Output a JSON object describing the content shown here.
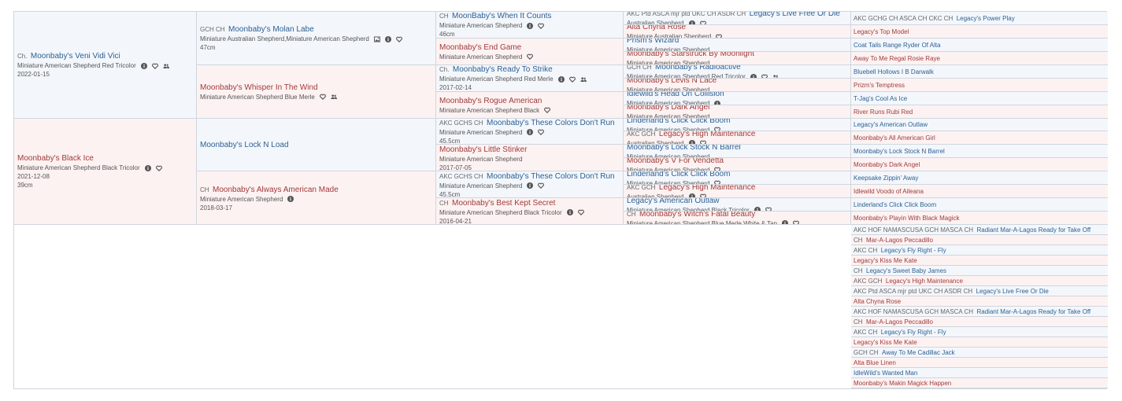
{
  "dogs": [
    {
      "gen": 0,
      "pos": 0,
      "sex": "sire",
      "title": "Ch.",
      "name": "Moonbaby's Veni Vidi Vici",
      "breed": "Miniature American Shepherd Red Tricolor",
      "date": "2022-01-15",
      "height": "",
      "icons": [
        "info-icon",
        "heart-icon",
        "people-icon"
      ]
    },
    {
      "gen": 0,
      "pos": 1,
      "sex": "dam",
      "title": "",
      "name": "Moonbaby's Black Ice",
      "breed": "Miniature American Shepherd Black Tricolor",
      "date": "2021-12-08",
      "height": "39cm",
      "icons": [
        "info-icon",
        "heart-icon"
      ]
    },
    {
      "gen": 1,
      "pos": 0,
      "sex": "sire",
      "title": "GCH CH",
      "name": "Moonbaby's Molan Labe",
      "breed": "Miniature Australian Shepherd,Miniature American Shepherd",
      "date": "",
      "height": "47cm",
      "icons": [
        "image-icon",
        "info-icon",
        "heart-icon"
      ]
    },
    {
      "gen": 1,
      "pos": 1,
      "sex": "dam",
      "title": "",
      "name": "Moonbaby's Whisper In The Wind",
      "breed": "Miniature American Shepherd Blue Merle",
      "date": "",
      "height": "",
      "icons": [
        "heart-icon",
        "people-icon"
      ]
    },
    {
      "gen": 1,
      "pos": 2,
      "sex": "sire",
      "title": "",
      "name": "Moonbaby's Lock N Load",
      "breed": "",
      "date": "",
      "height": "",
      "icons": []
    },
    {
      "gen": 1,
      "pos": 3,
      "sex": "dam",
      "title": "CH",
      "name": "Moonbaby's Always American Made",
      "breed": "Miniature American Shepherd",
      "date": "2018-03-17",
      "height": "",
      "icons": [
        "info-icon"
      ]
    },
    {
      "gen": 2,
      "pos": 0,
      "sex": "sire",
      "title": "CH",
      "name": "MoonBaby's When It Counts",
      "breed": "Miniature American Shepherd",
      "date": "",
      "height": "46cm",
      "icons": [
        "info-icon",
        "heart-icon"
      ]
    },
    {
      "gen": 2,
      "pos": 1,
      "sex": "dam",
      "title": "",
      "name": "Moonbaby's End Game",
      "breed": "Miniature American Shepherd",
      "date": "",
      "height": "",
      "icons": [
        "heart-icon"
      ]
    },
    {
      "gen": 2,
      "pos": 2,
      "sex": "sire",
      "title": "Ch.",
      "name": "Moonbaby's Ready To Strike",
      "breed": "Miniature American Shepherd Red Merle",
      "date": "2017-02-14",
      "height": "",
      "icons": [
        "info-icon",
        "heart-icon",
        "people-icon"
      ]
    },
    {
      "gen": 2,
      "pos": 3,
      "sex": "dam",
      "title": "",
      "name": "Moonbaby's Rogue American",
      "breed": "Miniature American Shepherd Black",
      "date": "",
      "height": "",
      "icons": [
        "heart-icon"
      ]
    },
    {
      "gen": 2,
      "pos": 4,
      "sex": "sire",
      "title": "AKC GCHS CH",
      "name": "Moonbaby's These Colors Don't Run",
      "breed": "Miniature American Shepherd",
      "date": "",
      "height": "45.5cm",
      "icons": [
        "info-icon",
        "heart-icon"
      ]
    },
    {
      "gen": 2,
      "pos": 5,
      "sex": "dam",
      "title": "",
      "name": "Moonbaby's Little Stinker",
      "breed": "Miniature American Shepherd",
      "date": "2017-07-05",
      "height": "",
      "icons": []
    },
    {
      "gen": 2,
      "pos": 6,
      "sex": "sire",
      "title": "AKC GCHS CH",
      "name": "Moonbaby's These Colors Don't Run",
      "breed": "Miniature American Shepherd",
      "date": "",
      "height": "45.5cm",
      "icons": [
        "info-icon",
        "heart-icon"
      ]
    },
    {
      "gen": 2,
      "pos": 7,
      "sex": "dam",
      "title": "CH",
      "name": "Moonbaby's Best Kept Secret",
      "breed": "Miniature American Shepherd Black Tricolor",
      "date": "2016-04-21",
      "height": "",
      "icons": [
        "info-icon",
        "heart-icon"
      ]
    },
    {
      "gen": 3,
      "pos": 0,
      "sex": "sire",
      "title": "AKC Ptd ASCA mjr ptd UKC CH ASDR CH",
      "name": "Legacy's Live Free Or Die",
      "breed": "Australian Shepherd",
      "date": "",
      "height": "",
      "icons": [
        "info-icon",
        "heart-icon"
      ]
    },
    {
      "gen": 3,
      "pos": 1,
      "sex": "dam",
      "title": "",
      "name": "Alta Chyna Rose",
      "breed": "Miniature Australian Shepherd",
      "date": "",
      "height": "",
      "icons": [
        "heart-icon"
      ]
    },
    {
      "gen": 3,
      "pos": 2,
      "sex": "sire",
      "title": "",
      "name": "Prism's Wizard",
      "breed": "Miniature American Shepherd",
      "date": "",
      "height": "",
      "icons": []
    },
    {
      "gen": 3,
      "pos": 3,
      "sex": "dam",
      "title": "",
      "name": "Moonbaby's Starstruck By Moonlight",
      "breed": "Miniature American Shepherd",
      "date": "",
      "height": "",
      "icons": []
    },
    {
      "gen": 3,
      "pos": 4,
      "sex": "sire",
      "title": "GCH CH",
      "name": "Moonbaby's Radioactive",
      "breed": "Miniature American Shepherd Red Tricolor",
      "date": "",
      "height": "",
      "icons": [
        "info-icon",
        "heart-icon",
        "people-icon"
      ]
    },
    {
      "gen": 3,
      "pos": 5,
      "sex": "dam",
      "title": "",
      "name": "Moonbaby's Levis N Lace",
      "breed": "Miniature American Shepherd",
      "date": "",
      "height": "",
      "icons": []
    },
    {
      "gen": 3,
      "pos": 6,
      "sex": "sire",
      "title": "",
      "name": "Idlewild's Head On Collision",
      "breed": "Miniature American Shepherd",
      "date": "",
      "height": "",
      "icons": [
        "info-icon"
      ]
    },
    {
      "gen": 3,
      "pos": 7,
      "sex": "dam",
      "title": "",
      "name": "Moonbaby's Dark Angel",
      "breed": "Miniature American Shepherd",
      "date": "",
      "height": "",
      "icons": []
    },
    {
      "gen": 3,
      "pos": 8,
      "sex": "sire",
      "title": "",
      "name": "Linderland's Click Click Boom",
      "breed": "Miniature American Shepherd",
      "date": "",
      "height": "",
      "icons": [
        "heart-icon"
      ]
    },
    {
      "gen": 3,
      "pos": 9,
      "sex": "dam",
      "title": "AKC GCH",
      "name": "Legacy's High Maintenance",
      "breed": "Australian Shepherd",
      "date": "",
      "height": "",
      "icons": [
        "info-icon",
        "heart-icon"
      ]
    },
    {
      "gen": 3,
      "pos": 10,
      "sex": "sire",
      "title": "",
      "name": "Moonbaby's Lock Stock N Barrel",
      "breed": "Miniature American Shepherd",
      "date": "",
      "height": "",
      "icons": []
    },
    {
      "gen": 3,
      "pos": 11,
      "sex": "dam",
      "title": "",
      "name": "Moonbaby's V For Vendetta",
      "breed": "Miniature American Shepherd",
      "date": "",
      "height": "",
      "icons": [
        "heart-icon"
      ]
    },
    {
      "gen": 3,
      "pos": 12,
      "sex": "sire",
      "title": "",
      "name": "Linderland's Click Click Boom",
      "breed": "Miniature American Shepherd",
      "date": "",
      "height": "",
      "icons": [
        "heart-icon"
      ]
    },
    {
      "gen": 3,
      "pos": 13,
      "sex": "dam",
      "title": "AKC GCH",
      "name": "Legacy's High Maintenance",
      "breed": "Australian Shepherd",
      "date": "",
      "height": "",
      "icons": [
        "info-icon",
        "heart-icon"
      ]
    },
    {
      "gen": 3,
      "pos": 14,
      "sex": "sire",
      "title": "",
      "name": "Legacy's American Outlaw",
      "breed": "Miniature American Shepherd Black Tricolor",
      "date": "",
      "height": "",
      "icons": [
        "info-icon",
        "heart-icon"
      ]
    },
    {
      "gen": 3,
      "pos": 15,
      "sex": "dam",
      "title": "CH",
      "name": "Moonbaby's Witch's Fatal Beauty",
      "breed": "Miniature American Shepherd Blue Merle White & Tan",
      "date": "",
      "height": "",
      "icons": [
        "info-icon",
        "heart-icon"
      ]
    },
    {
      "gen": 4,
      "pos": 0,
      "sex": "sire",
      "title": "AKC GCHG CH ASCA CH CKC CH",
      "name": "Legacy's Power Play"
    },
    {
      "gen": 4,
      "pos": 1,
      "sex": "dam",
      "title": "",
      "name": "Legacy's Top Model"
    },
    {
      "gen": 4,
      "pos": 2,
      "sex": "sire",
      "title": "",
      "name": "Coat Tails Range Ryder Of Alta"
    },
    {
      "gen": 4,
      "pos": 3,
      "sex": "dam",
      "title": "",
      "name": "Away To Me Regal Rosie Raye"
    },
    {
      "gen": 4,
      "pos": 4,
      "sex": "sire",
      "title": "",
      "name": "Bluebell Hollows I B Darwalk"
    },
    {
      "gen": 4,
      "pos": 5,
      "sex": "dam",
      "title": "",
      "name": "Prizm's Temptress"
    },
    {
      "gen": 4,
      "pos": 6,
      "sex": "sire",
      "title": "",
      "name": "T-Jag's Cool As Ice"
    },
    {
      "gen": 4,
      "pos": 7,
      "sex": "dam",
      "title": "",
      "name": "River Runs Rubi Red"
    },
    {
      "gen": 4,
      "pos": 8,
      "sex": "sire",
      "title": "",
      "name": "Legacy's American Outlaw"
    },
    {
      "gen": 4,
      "pos": 9,
      "sex": "dam",
      "title": "",
      "name": "Moonbaby's All American Girl"
    },
    {
      "gen": 4,
      "pos": 10,
      "sex": "sire",
      "title": "",
      "name": "Moonbaby's Lock Stock N Barrel"
    },
    {
      "gen": 4,
      "pos": 11,
      "sex": "dam",
      "title": "",
      "name": "Moonbaby's Dark Angel"
    },
    {
      "gen": 4,
      "pos": 12,
      "sex": "sire",
      "title": "",
      "name": "Keepsake Zippin' Away"
    },
    {
      "gen": 4,
      "pos": 13,
      "sex": "dam",
      "title": "",
      "name": "Idlewild Voodo of Aileana"
    },
    {
      "gen": 4,
      "pos": 14,
      "sex": "sire",
      "title": "",
      "name": "Linderland's Click Click Boom"
    },
    {
      "gen": 4,
      "pos": 15,
      "sex": "dam",
      "title": "",
      "name": "Moonbaby's Playin With Black Magick"
    },
    {
      "gen": 4,
      "pos": 16,
      "sex": "sire",
      "title": "AKC HOF NAMASCUSA GCH MASCA CH",
      "name": "Radiant Mar-A-Lagos Ready for Take Off"
    },
    {
      "gen": 4,
      "pos": 17,
      "sex": "dam",
      "title": "CH",
      "name": "Mar-A-Lagos Peccadillo"
    },
    {
      "gen": 4,
      "pos": 18,
      "sex": "sire",
      "title": "AKC CH",
      "name": "Legacy's Fly Right - Fly"
    },
    {
      "gen": 4,
      "pos": 19,
      "sex": "dam",
      "title": "",
      "name": "Legacy's Kiss Me Kate"
    },
    {
      "gen": 4,
      "pos": 20,
      "sex": "sire",
      "title": "CH",
      "name": "Legacy's Sweet Baby James"
    },
    {
      "gen": 4,
      "pos": 21,
      "sex": "dam",
      "title": "AKC GCH",
      "name": "Legacy's High Maintenance"
    },
    {
      "gen": 4,
      "pos": 22,
      "sex": "sire",
      "title": "AKC Ptd ASCA mjr ptd UKC CH ASDR CH",
      "name": "Legacy's Live Free Or Die"
    },
    {
      "gen": 4,
      "pos": 23,
      "sex": "dam",
      "title": "",
      "name": "Alta Chyna Rose"
    },
    {
      "gen": 4,
      "pos": 24,
      "sex": "sire",
      "title": "AKC HOF NAMASCUSA GCH MASCA CH",
      "name": "Radiant Mar-A-Lagos Ready for Take Off"
    },
    {
      "gen": 4,
      "pos": 25,
      "sex": "dam",
      "title": "CH",
      "name": "Mar-A-Lagos Peccadillo"
    },
    {
      "gen": 4,
      "pos": 26,
      "sex": "sire",
      "title": "AKC CH",
      "name": "Legacy's Fly Right - Fly"
    },
    {
      "gen": 4,
      "pos": 27,
      "sex": "dam",
      "title": "",
      "name": "Legacy's Kiss Me Kate"
    },
    {
      "gen": 4,
      "pos": 28,
      "sex": "sire",
      "title": "GCH CH",
      "name": "Away To Me Cadillac Jack"
    },
    {
      "gen": 4,
      "pos": 29,
      "sex": "dam",
      "title": "",
      "name": "Alta Blue Linen"
    },
    {
      "gen": 4,
      "pos": 30,
      "sex": "sire",
      "title": "",
      "name": "IdleWild's Wanted Man"
    },
    {
      "gen": 4,
      "pos": 31,
      "sex": "dam",
      "title": "",
      "name": "Moonbaby's Makin Magick Happen"
    }
  ],
  "colors": {
    "sire_bg": "#f3f7fc",
    "dam_bg": "#fdf2f2",
    "sire_name": "#2d5f92",
    "dam_name": "#a13a3a",
    "border": "#cfd6dd"
  }
}
